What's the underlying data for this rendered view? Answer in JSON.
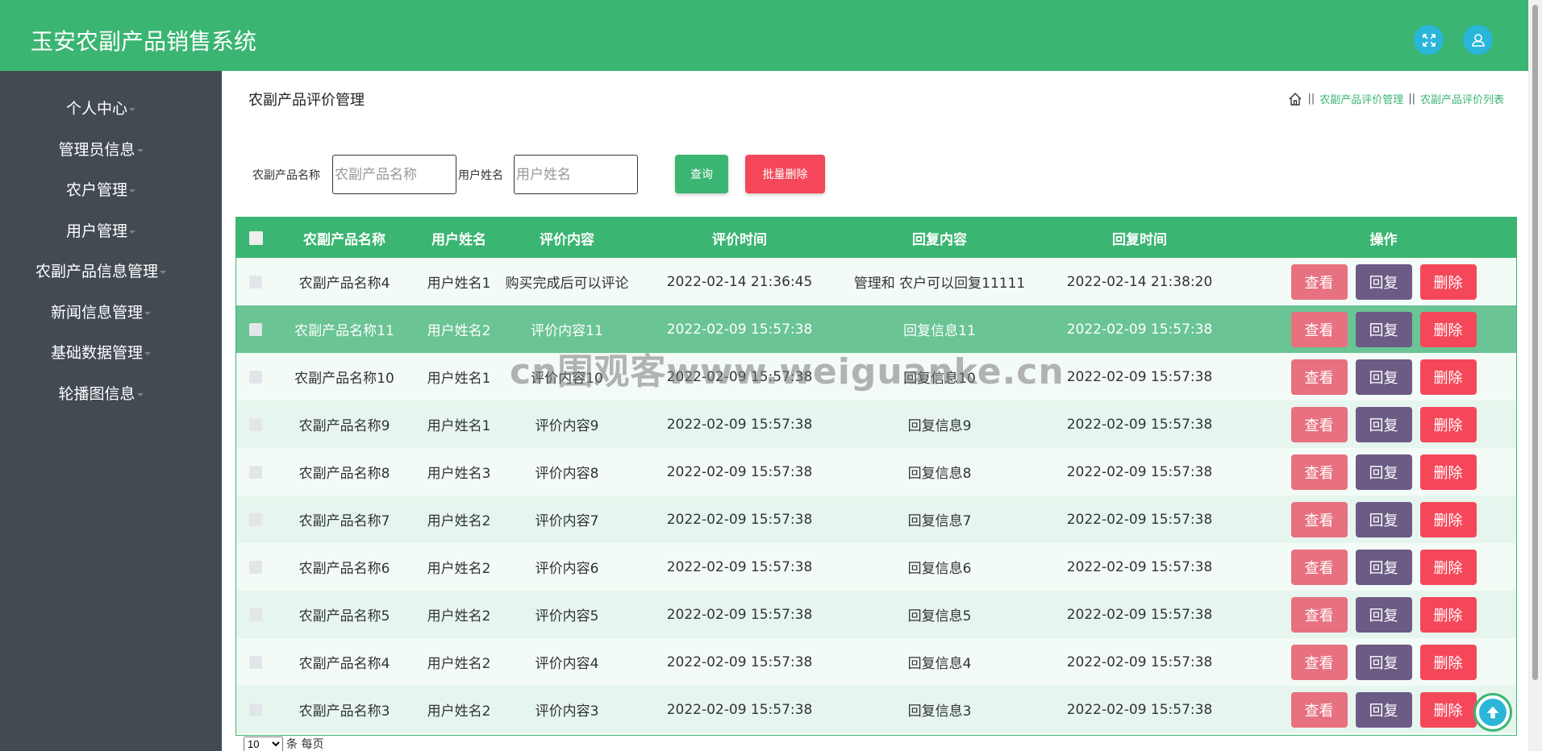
{
  "app": {
    "title": "玉安农副产品销售系统"
  },
  "sidebar": {
    "items": [
      {
        "label": "个人中心"
      },
      {
        "label": "管理员信息"
      },
      {
        "label": "农户管理"
      },
      {
        "label": "用户管理"
      },
      {
        "label": "农副产品信息管理"
      },
      {
        "label": "新闻信息管理"
      },
      {
        "label": "基础数据管理"
      },
      {
        "label": "轮播图信息"
      }
    ]
  },
  "page": {
    "title": "农副产品评价管理",
    "breadcrumb": [
      "农副产品评价管理",
      "农副产品评价列表"
    ]
  },
  "search": {
    "product_label": "农副产品名称",
    "product_placeholder": "农副产品名称",
    "user_label": "用户姓名",
    "user_placeholder": "用户姓名",
    "query_label": "查询",
    "batch_delete_label": "批量删除"
  },
  "table": {
    "columns": [
      "农副产品名称",
      "用户姓名",
      "评价内容",
      "评价时间",
      "回复内容",
      "回复时间",
      "操作"
    ],
    "action_labels": {
      "view": "查看",
      "reply": "回复",
      "delete": "删除"
    },
    "rows": [
      [
        "农副产品名称4",
        "用户姓名1",
        "购买完成后可以评论",
        "2022-02-14 21:36:45",
        "管理和 农户可以回复11111",
        "2022-02-14 21:38:20"
      ],
      [
        "农副产品名称11",
        "用户姓名2",
        "评价内容11",
        "2022-02-09 15:57:38",
        "回复信息11",
        "2022-02-09 15:57:38"
      ],
      [
        "农副产品名称10",
        "用户姓名1",
        "评价内容10",
        "2022-02-09 15:57:38",
        "回复信息10",
        "2022-02-09 15:57:38"
      ],
      [
        "农副产品名称9",
        "用户姓名1",
        "评价内容9",
        "2022-02-09 15:57:38",
        "回复信息9",
        "2022-02-09 15:57:38"
      ],
      [
        "农副产品名称8",
        "用户姓名3",
        "评价内容8",
        "2022-02-09 15:57:38",
        "回复信息8",
        "2022-02-09 15:57:38"
      ],
      [
        "农副产品名称7",
        "用户姓名2",
        "评价内容7",
        "2022-02-09 15:57:38",
        "回复信息7",
        "2022-02-09 15:57:38"
      ],
      [
        "农副产品名称6",
        "用户姓名2",
        "评价内容6",
        "2022-02-09 15:57:38",
        "回复信息6",
        "2022-02-09 15:57:38"
      ],
      [
        "农副产品名称5",
        "用户姓名2",
        "评价内容5",
        "2022-02-09 15:57:38",
        "回复信息5",
        "2022-02-09 15:57:38"
      ],
      [
        "农副产品名称4",
        "用户姓名2",
        "评价内容4",
        "2022-02-09 15:57:38",
        "回复信息4",
        "2022-02-09 15:57:38"
      ],
      [
        "农副产品名称3",
        "用户姓名2",
        "评价内容3",
        "2022-02-09 15:57:38",
        "回复信息3",
        "2022-02-09 15:57:38"
      ]
    ],
    "highlighted_row": 1
  },
  "pagination": {
    "page_size": "10",
    "suffix": "条 每页"
  },
  "watermark": "cn围观客www.weiguanke.cn",
  "colors": {
    "primary": "#3bb572",
    "sidebar": "#424a52",
    "danger": "#f4485a",
    "view": "#e87180",
    "reply": "#6b5b85",
    "icon_bg": "#29b6d9"
  },
  "icons": [
    "fullscreen-icon",
    "user-icon",
    "home-icon",
    "arrow-up-icon"
  ]
}
